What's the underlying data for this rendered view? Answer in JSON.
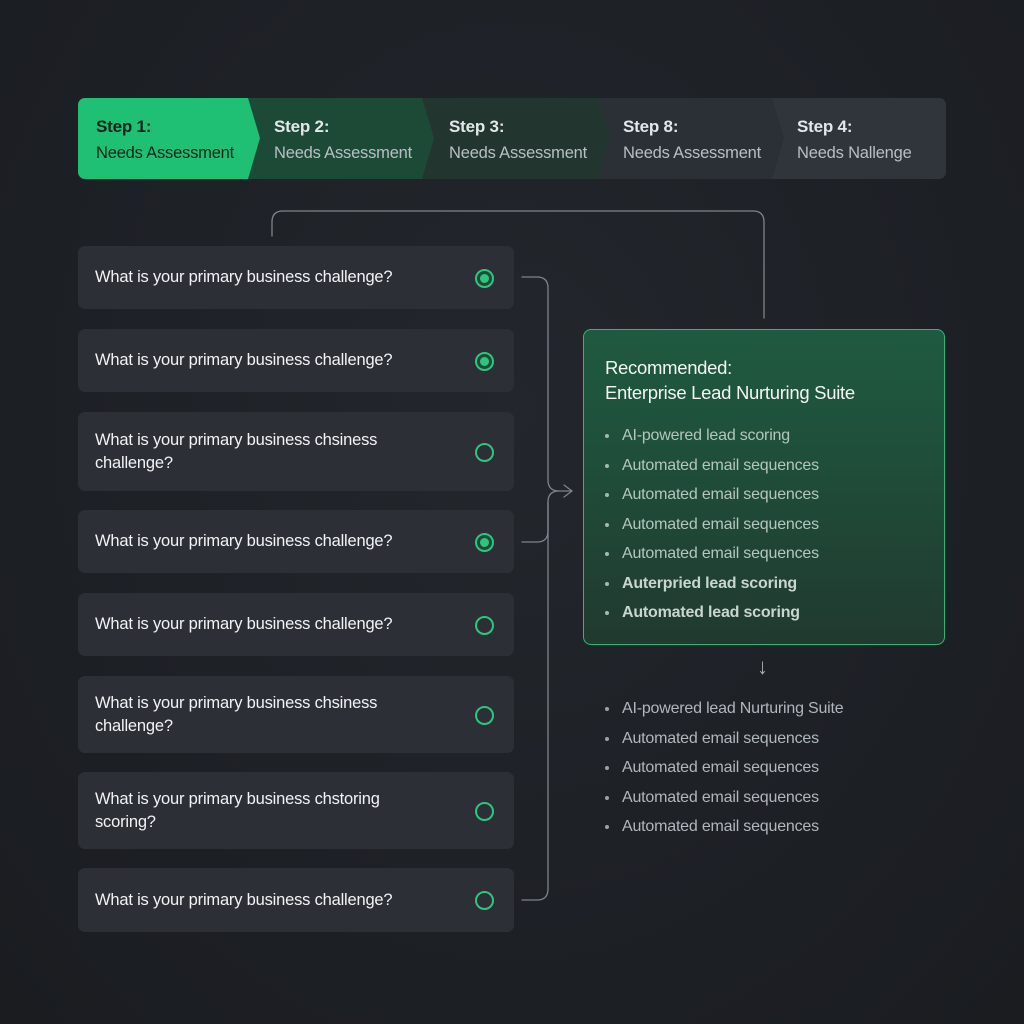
{
  "stepper": {
    "steps": [
      {
        "number": "Step 1:",
        "label": "Needs Assessment",
        "state": "active"
      },
      {
        "number": "Step 2:",
        "label": "Needs Assessment",
        "state": "pending"
      },
      {
        "number": "Step 3:",
        "label": "Needs Assessment",
        "state": "pending"
      },
      {
        "number": "Step 8:",
        "label": "Needs Assessment",
        "state": "pending"
      },
      {
        "number": "Step 4:",
        "label": "Needs Nallenge",
        "state": "pending"
      }
    ]
  },
  "questions": [
    {
      "text": "What is your primary business challenge?",
      "selected": true
    },
    {
      "text": "What is your primary business challenge?",
      "selected": true
    },
    {
      "text": "What is your primary business chsiness challenge?",
      "selected": false
    },
    {
      "text": "What is your primary business challenge?",
      "selected": true
    },
    {
      "text": "What is your primary business challenge?",
      "selected": false
    },
    {
      "text": "What is your primary business chsiness challenge?",
      "selected": false
    },
    {
      "text": "What is your primary business chstoring scoring?",
      "selected": false
    },
    {
      "text": "What is your primary business challenge?",
      "selected": false
    }
  ],
  "recommendation": {
    "title_line1": "Recommended:",
    "title_line2": "Enterprise Lead Nurturing Suite",
    "features": [
      "AI-powered lead scoring",
      "Automated email sequences",
      "Automated email sequences",
      "Automated email sequences",
      "Automated email sequences",
      "Auterpried lead scoring",
      "Automated lead scoring"
    ]
  },
  "details": {
    "arrow_icon": "arrow-down-icon",
    "items": [
      "AI-powered lead Nurturing Suite",
      "Automated email sequences",
      "Automated email sequences",
      "Automated email sequences",
      "Automated email sequences"
    ]
  },
  "colors": {
    "accent": "#1fbf74",
    "background": "#1d2025",
    "card": "#2c2f35",
    "recommend_bg": "#1f5a40",
    "recommend_border": "#33b673"
  }
}
